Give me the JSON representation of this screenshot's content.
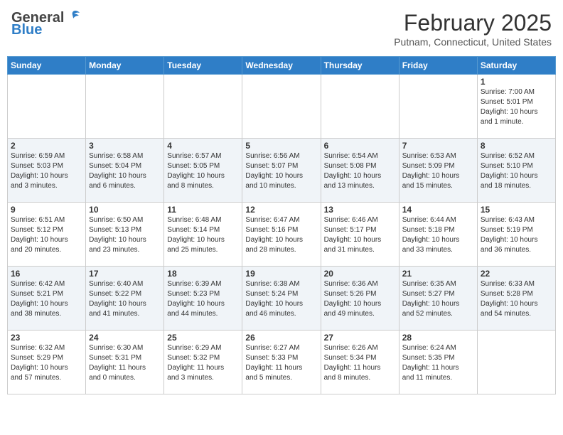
{
  "header": {
    "logo_general": "General",
    "logo_blue": "Blue",
    "month_year": "February 2025",
    "location": "Putnam, Connecticut, United States"
  },
  "weekdays": [
    "Sunday",
    "Monday",
    "Tuesday",
    "Wednesday",
    "Thursday",
    "Friday",
    "Saturday"
  ],
  "weeks": [
    [
      {
        "day": "",
        "info": ""
      },
      {
        "day": "",
        "info": ""
      },
      {
        "day": "",
        "info": ""
      },
      {
        "day": "",
        "info": ""
      },
      {
        "day": "",
        "info": ""
      },
      {
        "day": "",
        "info": ""
      },
      {
        "day": "1",
        "info": "Sunrise: 7:00 AM\nSunset: 5:01 PM\nDaylight: 10 hours\nand 1 minute."
      }
    ],
    [
      {
        "day": "2",
        "info": "Sunrise: 6:59 AM\nSunset: 5:03 PM\nDaylight: 10 hours\nand 3 minutes."
      },
      {
        "day": "3",
        "info": "Sunrise: 6:58 AM\nSunset: 5:04 PM\nDaylight: 10 hours\nand 6 minutes."
      },
      {
        "day": "4",
        "info": "Sunrise: 6:57 AM\nSunset: 5:05 PM\nDaylight: 10 hours\nand 8 minutes."
      },
      {
        "day": "5",
        "info": "Sunrise: 6:56 AM\nSunset: 5:07 PM\nDaylight: 10 hours\nand 10 minutes."
      },
      {
        "day": "6",
        "info": "Sunrise: 6:54 AM\nSunset: 5:08 PM\nDaylight: 10 hours\nand 13 minutes."
      },
      {
        "day": "7",
        "info": "Sunrise: 6:53 AM\nSunset: 5:09 PM\nDaylight: 10 hours\nand 15 minutes."
      },
      {
        "day": "8",
        "info": "Sunrise: 6:52 AM\nSunset: 5:10 PM\nDaylight: 10 hours\nand 18 minutes."
      }
    ],
    [
      {
        "day": "9",
        "info": "Sunrise: 6:51 AM\nSunset: 5:12 PM\nDaylight: 10 hours\nand 20 minutes."
      },
      {
        "day": "10",
        "info": "Sunrise: 6:50 AM\nSunset: 5:13 PM\nDaylight: 10 hours\nand 23 minutes."
      },
      {
        "day": "11",
        "info": "Sunrise: 6:48 AM\nSunset: 5:14 PM\nDaylight: 10 hours\nand 25 minutes."
      },
      {
        "day": "12",
        "info": "Sunrise: 6:47 AM\nSunset: 5:16 PM\nDaylight: 10 hours\nand 28 minutes."
      },
      {
        "day": "13",
        "info": "Sunrise: 6:46 AM\nSunset: 5:17 PM\nDaylight: 10 hours\nand 31 minutes."
      },
      {
        "day": "14",
        "info": "Sunrise: 6:44 AM\nSunset: 5:18 PM\nDaylight: 10 hours\nand 33 minutes."
      },
      {
        "day": "15",
        "info": "Sunrise: 6:43 AM\nSunset: 5:19 PM\nDaylight: 10 hours\nand 36 minutes."
      }
    ],
    [
      {
        "day": "16",
        "info": "Sunrise: 6:42 AM\nSunset: 5:21 PM\nDaylight: 10 hours\nand 38 minutes."
      },
      {
        "day": "17",
        "info": "Sunrise: 6:40 AM\nSunset: 5:22 PM\nDaylight: 10 hours\nand 41 minutes."
      },
      {
        "day": "18",
        "info": "Sunrise: 6:39 AM\nSunset: 5:23 PM\nDaylight: 10 hours\nand 44 minutes."
      },
      {
        "day": "19",
        "info": "Sunrise: 6:38 AM\nSunset: 5:24 PM\nDaylight: 10 hours\nand 46 minutes."
      },
      {
        "day": "20",
        "info": "Sunrise: 6:36 AM\nSunset: 5:26 PM\nDaylight: 10 hours\nand 49 minutes."
      },
      {
        "day": "21",
        "info": "Sunrise: 6:35 AM\nSunset: 5:27 PM\nDaylight: 10 hours\nand 52 minutes."
      },
      {
        "day": "22",
        "info": "Sunrise: 6:33 AM\nSunset: 5:28 PM\nDaylight: 10 hours\nand 54 minutes."
      }
    ],
    [
      {
        "day": "23",
        "info": "Sunrise: 6:32 AM\nSunset: 5:29 PM\nDaylight: 10 hours\nand 57 minutes."
      },
      {
        "day": "24",
        "info": "Sunrise: 6:30 AM\nSunset: 5:31 PM\nDaylight: 11 hours\nand 0 minutes."
      },
      {
        "day": "25",
        "info": "Sunrise: 6:29 AM\nSunset: 5:32 PM\nDaylight: 11 hours\nand 3 minutes."
      },
      {
        "day": "26",
        "info": "Sunrise: 6:27 AM\nSunset: 5:33 PM\nDaylight: 11 hours\nand 5 minutes."
      },
      {
        "day": "27",
        "info": "Sunrise: 6:26 AM\nSunset: 5:34 PM\nDaylight: 11 hours\nand 8 minutes."
      },
      {
        "day": "28",
        "info": "Sunrise: 6:24 AM\nSunset: 5:35 PM\nDaylight: 11 hours\nand 11 minutes."
      },
      {
        "day": "",
        "info": ""
      }
    ]
  ]
}
